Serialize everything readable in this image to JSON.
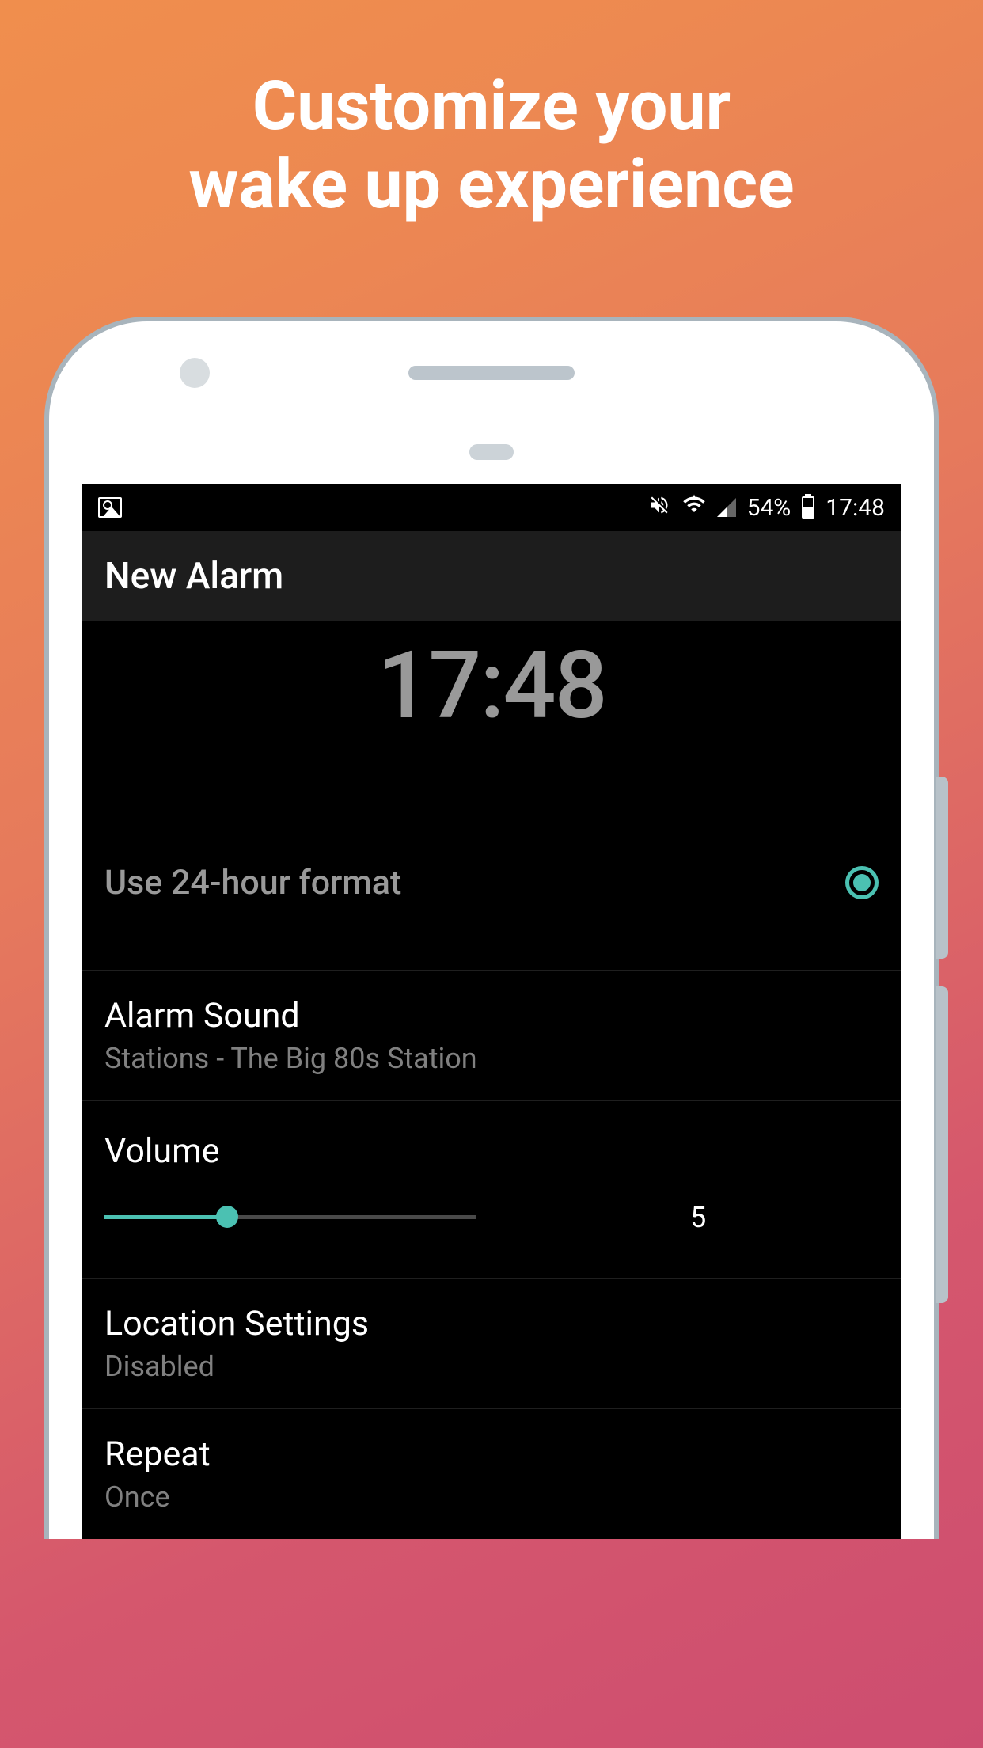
{
  "promo": {
    "title_line1": "Customize your",
    "title_line2": "wake up experience"
  },
  "status_bar": {
    "battery_percent": "54%",
    "time": "17:48"
  },
  "header": {
    "title": "New Alarm"
  },
  "alarm": {
    "time": "17:48"
  },
  "settings": {
    "format": {
      "label": "Use 24-hour format",
      "enabled": true
    },
    "sound": {
      "title": "Alarm Sound",
      "value": "Stations - The Big 80s Station"
    },
    "volume": {
      "title": "Volume",
      "value": "5",
      "percent": 33
    },
    "location": {
      "title": "Location Settings",
      "value": "Disabled"
    },
    "repeat": {
      "title": "Repeat",
      "value": "Once"
    }
  },
  "colors": {
    "accent": "#4bc1b2"
  }
}
